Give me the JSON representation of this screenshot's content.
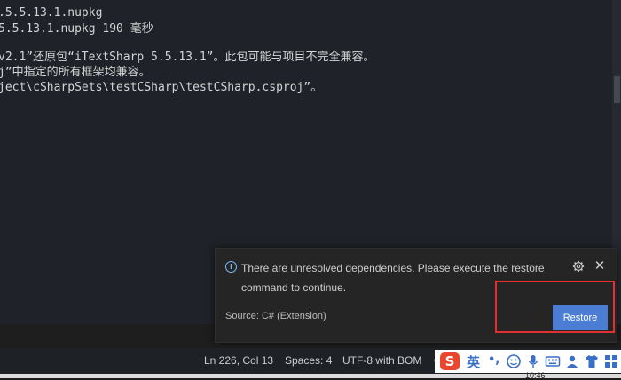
{
  "terminal": {
    "lines": [
      ".5.5.13.1.nupkg",
      "5.5.13.1.nupkg 190 毫秒",
      "v2.1”还原包“iTextSharp 5.5.13.1”。此包可能与项目不完全兼容。",
      "j”中指定的所有框架均兼容。",
      "ject\\cSharpSets\\testCSharp\\testCSharp.csproj”。"
    ]
  },
  "notification": {
    "message": "There are unresolved dependencies. Please execute the restore command to continue.",
    "source": "Source: C# (Extension)",
    "restore_label": "Restore",
    "close_glyph": "✕"
  },
  "statusbar": {
    "position": "Ln 226, Col 13",
    "spaces": "Spaces: 4",
    "encoding": "UTF-8 with BOM",
    "partial": "C"
  },
  "ime": {
    "logo": "S",
    "lang": "英",
    "punct": "•,"
  },
  "taskbar": {
    "time": "10:46"
  },
  "colors": {
    "accent": "#4c7dd4",
    "highlight": "#e03030",
    "info": "#75beff"
  }
}
